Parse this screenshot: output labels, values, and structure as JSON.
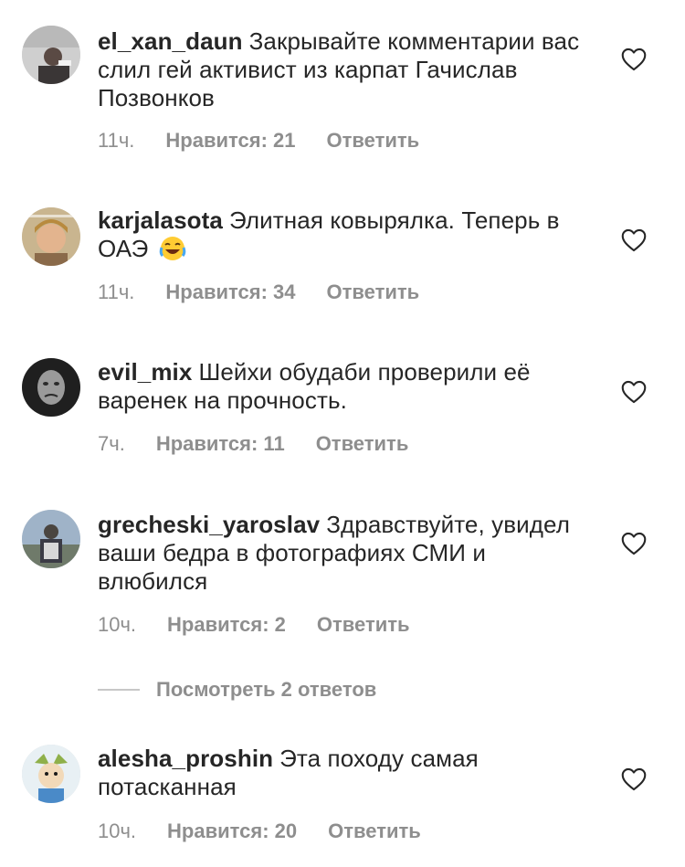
{
  "comments": [
    {
      "username": "el_xan_daun",
      "text": "Закрывайте комментарии вас слил гей активист из карпат Гачислав Позвонков",
      "time": "11ч.",
      "likes": "Нравится: 21",
      "reply": "Ответить"
    },
    {
      "username": "karjalasota",
      "text": "Элитная ковырялка. Теперь в ОАЭ",
      "emoji": "face-with-tears-of-joy",
      "time": "11ч.",
      "likes": "Нравится: 34",
      "reply": "Ответить"
    },
    {
      "username": "evil_mix",
      "text": "Шейхи обудаби проверили её варенек на прочность.",
      "time": "7ч.",
      "likes": "Нравится: 11",
      "reply": "Ответить"
    },
    {
      "username": "grecheski_yaroslav",
      "text": "Здравствуйте, увидел ваши бедра в фотографиях СМИ и влюбился",
      "time": "10ч.",
      "likes": "Нравится: 2",
      "reply": "Ответить"
    },
    {
      "username": "alesha_proshin",
      "text": "Эта походу самая потасканная",
      "time": "10ч.",
      "likes": "Нравится: 20",
      "reply": "Ответить"
    }
  ],
  "view_replies": "Посмотреть 2 ответов",
  "icons": {
    "like": "heart-outline-icon"
  },
  "colors": {
    "text": "#262626",
    "secondary": "#8e8e8e",
    "divider": "#c7c7c7"
  }
}
